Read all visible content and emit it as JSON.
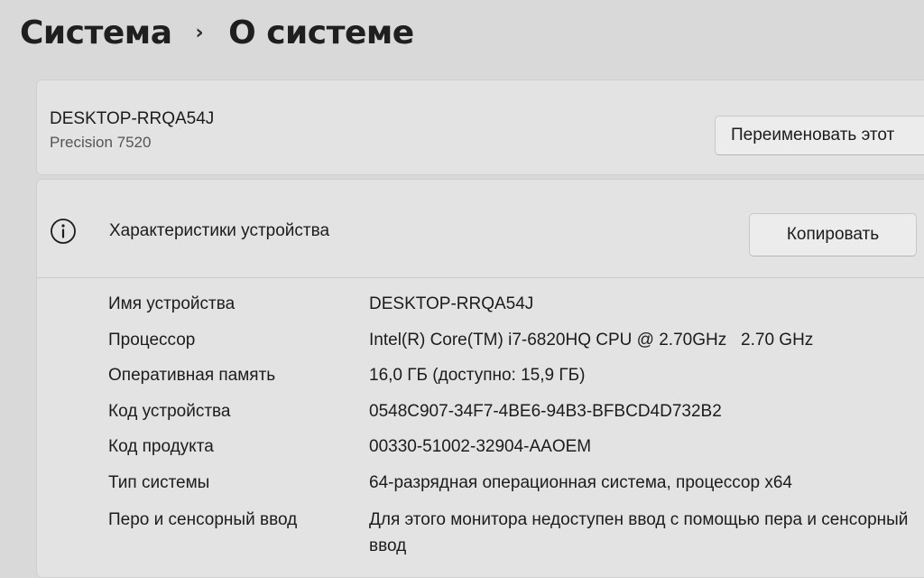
{
  "breadcrumb": {
    "parent": "Система",
    "separator": "›",
    "current": "О системе"
  },
  "device_card": {
    "name": "DESKTOP-RRQA54J",
    "model": "Precision 7520",
    "rename_button": "Переименовать этот"
  },
  "specs": {
    "icon": "info-icon",
    "title": "Характеристики устройства",
    "copy_button": "Копировать",
    "rows": [
      {
        "label": "Имя устройства",
        "value": "DESKTOP-RRQA54J"
      },
      {
        "label": "Процессор",
        "value": "Intel(R) Core(TM) i7-6820HQ CPU @ 2.70GHz   2.70 GHz"
      },
      {
        "label": "Оперативная память",
        "value": "16,0 ГБ (доступно: 15,9 ГБ)"
      },
      {
        "label": "Код устройства",
        "value": "0548C907-34F7-4BE6-94B3-BFBCD4D732B2"
      },
      {
        "label": "Код продукта",
        "value": "00330-51002-32904-AAOEM"
      },
      {
        "label": "Тип системы",
        "value": "64-разрядная операционная система, процессор x64"
      },
      {
        "label": "Перо и сенсорный ввод",
        "value": "Для этого монитора недоступен ввод с помощью пера и сенсорный ввод"
      }
    ]
  }
}
